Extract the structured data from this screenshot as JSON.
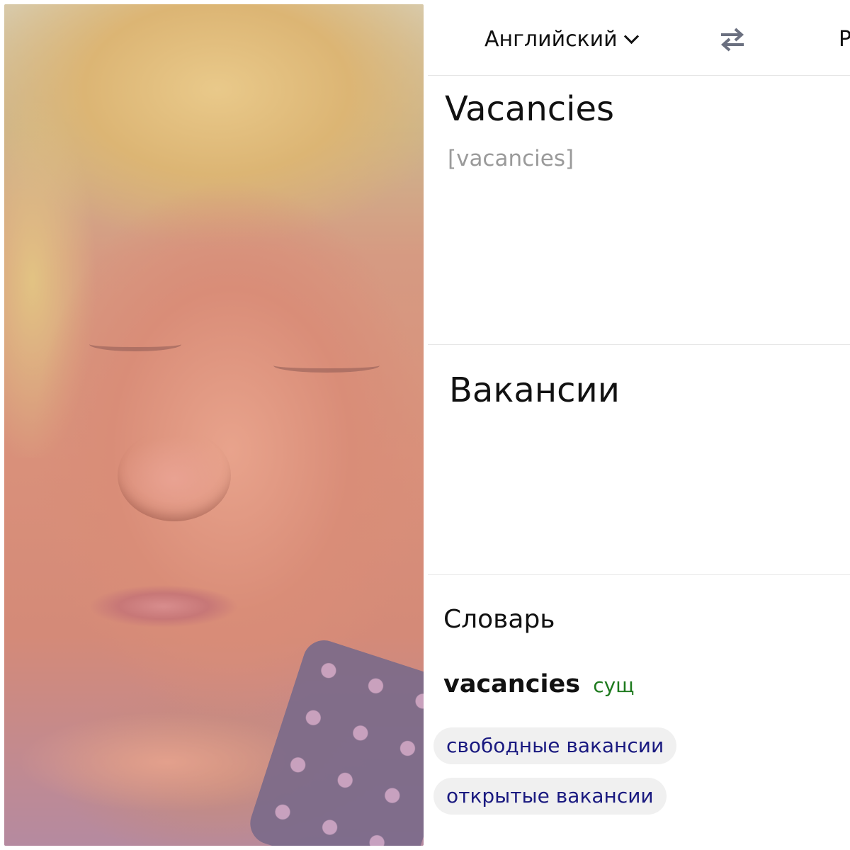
{
  "translator": {
    "source_language": "Английский",
    "target_language": "Р",
    "source_text": "Vacancies",
    "transcription": "[vacancies]",
    "translation": "Вакансии"
  },
  "dictionary": {
    "title": "Словарь",
    "word": "vacancies",
    "part_of_speech": "сущ",
    "suggestions": [
      "свободные вакансии",
      "открытые вакансии"
    ]
  },
  "icons": {
    "dropdown": "chevron-down-icon",
    "swap": "swap-arrows-icon"
  },
  "colors": {
    "part_of_speech": "#1e7a1e",
    "suggestion_text": "#1a1a80",
    "transcription": "#9a9a9a"
  }
}
